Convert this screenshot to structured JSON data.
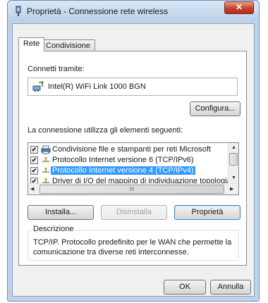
{
  "window": {
    "title": "Proprietà - Connessione rete wireless",
    "close_glyph": "✕"
  },
  "tabs": [
    {
      "label": "Rete",
      "active": true
    },
    {
      "label": "Condivisione",
      "active": false
    }
  ],
  "connect_via": {
    "label": "Connetti tramite:",
    "adapter": "Intel(R) WiFi Link 1000 BGN",
    "configure_button": "Configura..."
  },
  "components": {
    "label": "La connessione utilizza gli elementi seguenti:",
    "items": [
      {
        "label": "Condivisione file e stampanti per reti Microsoft",
        "checked": true,
        "selected": false,
        "icon": "printer-share-icon"
      },
      {
        "label": "Protocollo Internet versione 6 (TCP/IPv6)",
        "checked": true,
        "selected": false,
        "icon": "network-protocol-icon"
      },
      {
        "label": "Protocollo Internet versione 4 (TCP/IPv4)",
        "checked": true,
        "selected": true,
        "icon": "network-protocol-icon"
      },
      {
        "label": "Driver di I/O del mapping di individuazione topologia liv",
        "checked": true,
        "selected": false,
        "icon": "network-protocol-icon"
      }
    ],
    "hscroll_grip": "III"
  },
  "actions": {
    "install": "Installa...",
    "uninstall": "Disinstalla",
    "properties": "Proprietà"
  },
  "description": {
    "label": "Descrizione",
    "text": "TCP/IP. Protocollo predefinito per le WAN che permette la comunicazione tra diverse reti interconnesse."
  },
  "dialog_buttons": {
    "ok": "OK",
    "cancel": "Annulla"
  },
  "colors": {
    "selection": "#3399ff",
    "close_button": "#c7402a",
    "window_frame": "#bcd3ea"
  }
}
